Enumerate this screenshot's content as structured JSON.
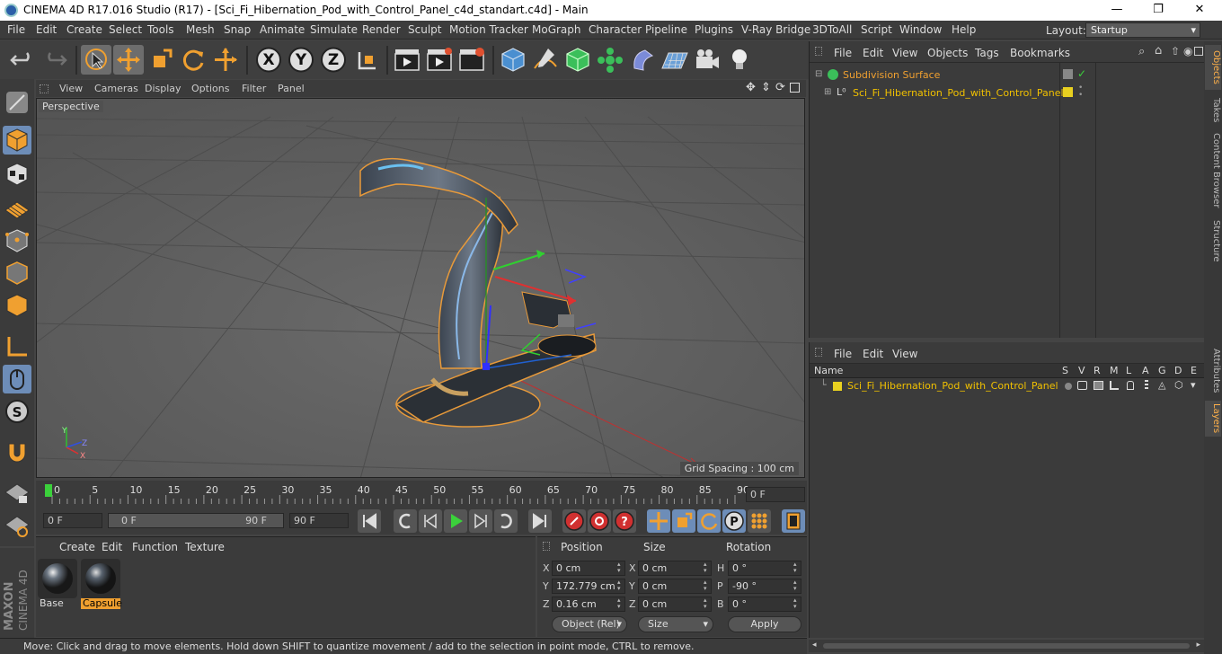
{
  "window": {
    "title": "CINEMA 4D R17.016 Studio (R17) - [Sci_Fi_Hibernation_Pod_with_Control_Panel_c4d_standart.c4d] - Main",
    "minimize": "—",
    "maximize": "❐",
    "close": "✕"
  },
  "menubar": {
    "items": [
      "File",
      "Edit",
      "Create",
      "Select",
      "Tools",
      "Mesh",
      "Snap",
      "Animate",
      "Simulate",
      "Render",
      "Sculpt",
      "Motion Tracker",
      "MoGraph",
      "Character",
      "Pipeline",
      "Plugins",
      "V-Ray Bridge",
      "3DToAll",
      "Script",
      "Window",
      "Help"
    ],
    "layout_label": "Layout:",
    "layout_value": "Startup"
  },
  "viewport": {
    "menu": [
      "View",
      "Cameras",
      "Display",
      "Options",
      "Filter",
      "Panel"
    ],
    "label": "Perspective",
    "grid_spacing": "Grid Spacing : 100 cm",
    "axis_x": "X",
    "axis_y": "Y",
    "axis_z": "Z"
  },
  "timeline": {
    "ticks": [
      "0",
      "5",
      "10",
      "15",
      "20",
      "25",
      "30",
      "35",
      "40",
      "45",
      "50",
      "55",
      "60",
      "65",
      "70",
      "75",
      "80",
      "85",
      "90"
    ],
    "current_frame": "0 F"
  },
  "playbar": {
    "start_field": "0 F",
    "range_start": "0 F",
    "range_end": "90 F",
    "end_field": "90 F"
  },
  "material_panel": {
    "menu": [
      "Create",
      "Edit",
      "Function",
      "Texture"
    ],
    "materials": [
      {
        "name": "Base",
        "selected": false
      },
      {
        "name": "Capsule",
        "selected": true
      }
    ]
  },
  "coordinates": {
    "headers": {
      "position": "Position",
      "size": "Size",
      "rotation": "Rotation"
    },
    "rows": [
      {
        "axis": "X",
        "position": "0 cm",
        "size_axis": "X",
        "size": "0 cm",
        "rot_axis": "H",
        "rotation": "0 °"
      },
      {
        "axis": "Y",
        "position": "172.779 cm",
        "size_axis": "Y",
        "size": "0 cm",
        "rot_axis": "P",
        "rotation": "-90 °"
      },
      {
        "axis": "Z",
        "position": "0.16 cm",
        "size_axis": "Z",
        "size": "0 cm",
        "rot_axis": "B",
        "rotation": "0 °"
      }
    ],
    "mode": "Object (Rel)",
    "size_mode": "Size",
    "apply": "Apply"
  },
  "status": "Move: Click and drag to move elements. Hold down SHIFT to quantize movement / add to the selection in point mode, CTRL to remove.",
  "objects_panel": {
    "menu": [
      "File",
      "Edit",
      "View",
      "Objects",
      "Tags",
      "Bookmarks"
    ],
    "items": [
      {
        "name": "Subdivision Surface",
        "color": "#f0a030"
      },
      {
        "name": "Sci_Fi_Hibernation_Pod_with_Control_Panel",
        "color": "#f0c000"
      }
    ]
  },
  "layers_panel": {
    "menu": [
      "File",
      "Edit",
      "View"
    ],
    "columns": [
      "Name",
      "S",
      "V",
      "R",
      "M",
      "L",
      "A",
      "G",
      "D",
      "E"
    ],
    "layers": [
      {
        "name": "Sci_Fi_Hibernation_Pod_with_Control_Panel",
        "color": "#e8d020"
      }
    ]
  },
  "right_tabs": [
    "Objects",
    "Takes",
    "Content Browser",
    "Structure",
    "Attributes",
    "Layers"
  ],
  "branding": {
    "maxon": "MAXON",
    "product": "CINEMA 4D"
  },
  "colors": {
    "accent": "#f0a030",
    "selection": "#ffb14a"
  }
}
